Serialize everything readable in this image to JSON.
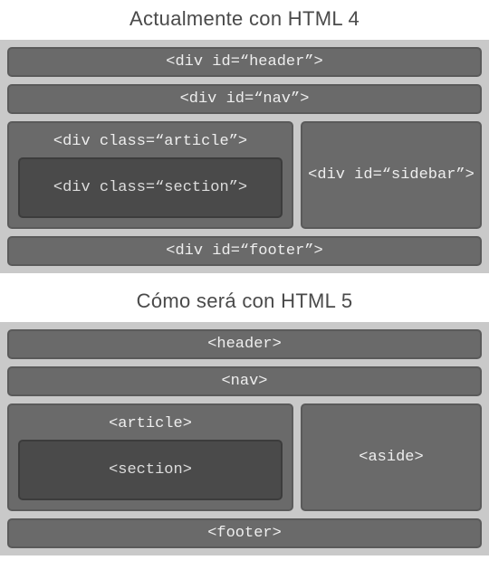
{
  "html4": {
    "title": "Actualmente con HTML 4",
    "header": "<div id=“header”>",
    "nav": "<div id=“nav”>",
    "article": "<div class=“article”>",
    "section": "<div class=“section”>",
    "sidebar": "<div id=“sidebar”>",
    "footer": "<div id=“footer”>"
  },
  "html5": {
    "title": "Cómo será con HTML 5",
    "header": "<header>",
    "nav": "<nav>",
    "article": "<article>",
    "section": "<section>",
    "aside": "<aside>",
    "footer": "<footer>"
  }
}
